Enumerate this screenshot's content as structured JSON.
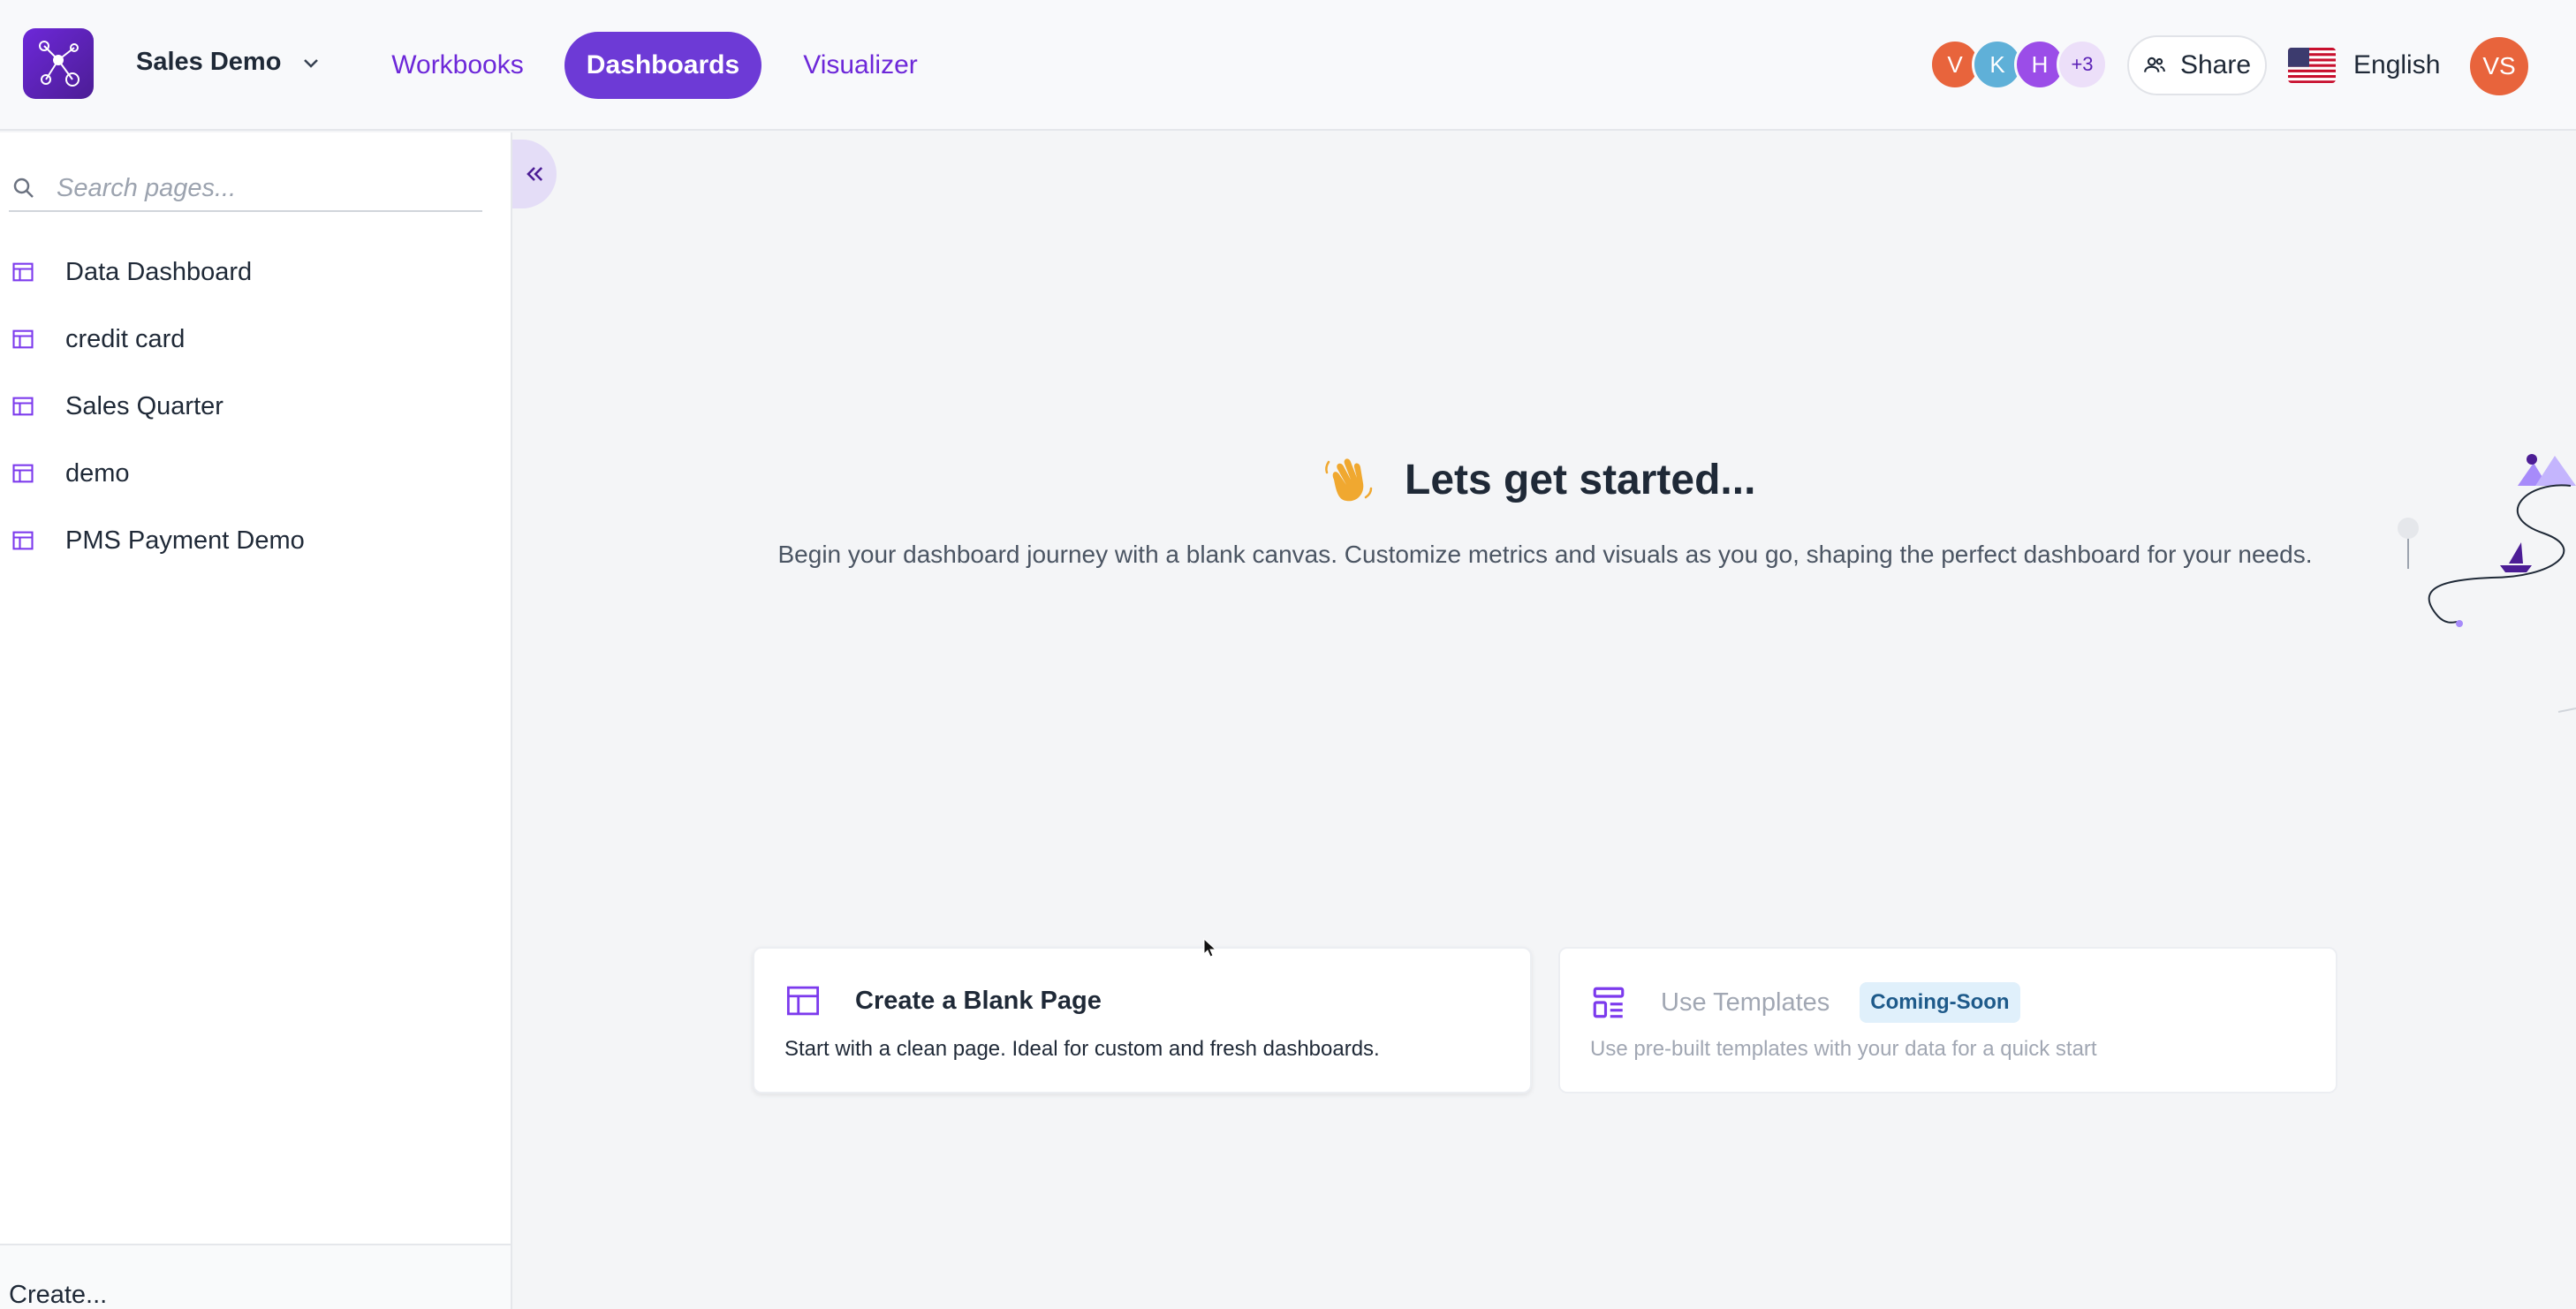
{
  "header": {
    "project_name": "Sales Demo",
    "nav": {
      "workbooks": "Workbooks",
      "dashboards": "Dashboards",
      "visualizer": "Visualizer"
    },
    "collaborators": [
      {
        "initial": "V",
        "color": "#e8643c"
      },
      {
        "initial": "K",
        "color": "#5fb0d8"
      },
      {
        "initial": "H",
        "color": "#9b4de8"
      }
    ],
    "collaborators_more": "+3",
    "share_label": "Share",
    "language": "English",
    "user_initials": "VS"
  },
  "sidebar": {
    "search_placeholder": "Search pages...",
    "pages": [
      {
        "label": "Data Dashboard"
      },
      {
        "label": "credit card"
      },
      {
        "label": "Sales Quarter"
      },
      {
        "label": "demo"
      },
      {
        "label": "PMS Payment Demo"
      }
    ],
    "create_label": "Create..."
  },
  "main": {
    "title": "Lets get started...",
    "subtitle": "Begin your dashboard journey with a blank canvas. Customize metrics and visuals as you go, shaping the perfect dashboard for your needs.",
    "cards": {
      "blank": {
        "title": "Create a Blank Page",
        "desc": "Start with a clean page. Ideal for custom and fresh dashboards."
      },
      "templates": {
        "title": "Use Templates",
        "badge": "Coming-Soon",
        "desc": "Use pre-built templates with your data for a quick start"
      }
    }
  },
  "colors": {
    "accent": "#6d3ad6",
    "accent_text": "#6d28d9",
    "wave": "#f0a830"
  }
}
